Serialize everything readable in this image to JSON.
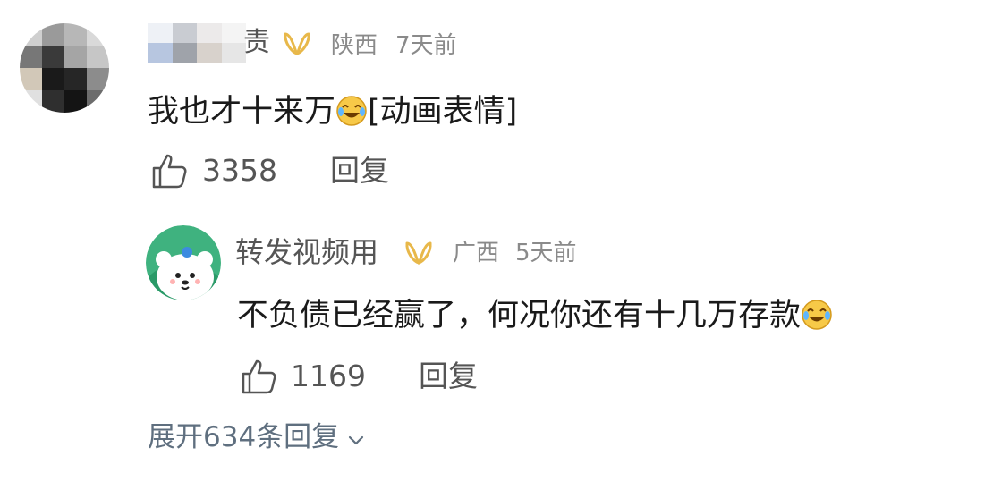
{
  "comment": {
    "author": {
      "name_suffix": "责",
      "vip_badge": "ꝏ",
      "location": "陕西",
      "time": "7天前"
    },
    "text": "我也才十来万",
    "emoji_tag": "[动画表情]",
    "likes": "3358",
    "reply_label": "回复",
    "reply": {
      "author": {
        "name": "转发视频用",
        "vip_badge": "ꝏ",
        "location": "广西",
        "time": "5天前"
      },
      "text": "不负债已经赢了，何况你还有十几万存款",
      "likes": "1169",
      "reply_label": "回复"
    },
    "expand_label": "展开634条回复"
  },
  "colors": {
    "vip_gold": "#e8b84a",
    "meta_gray": "#8a8a8a",
    "avatar2_green": "#3fb27f",
    "expand_blue_gray": "#5f6f7f"
  },
  "icons": [
    "like-icon",
    "laugh-cry-emoji-icon",
    "chevron-down-icon",
    "vip-badge-icon"
  ]
}
